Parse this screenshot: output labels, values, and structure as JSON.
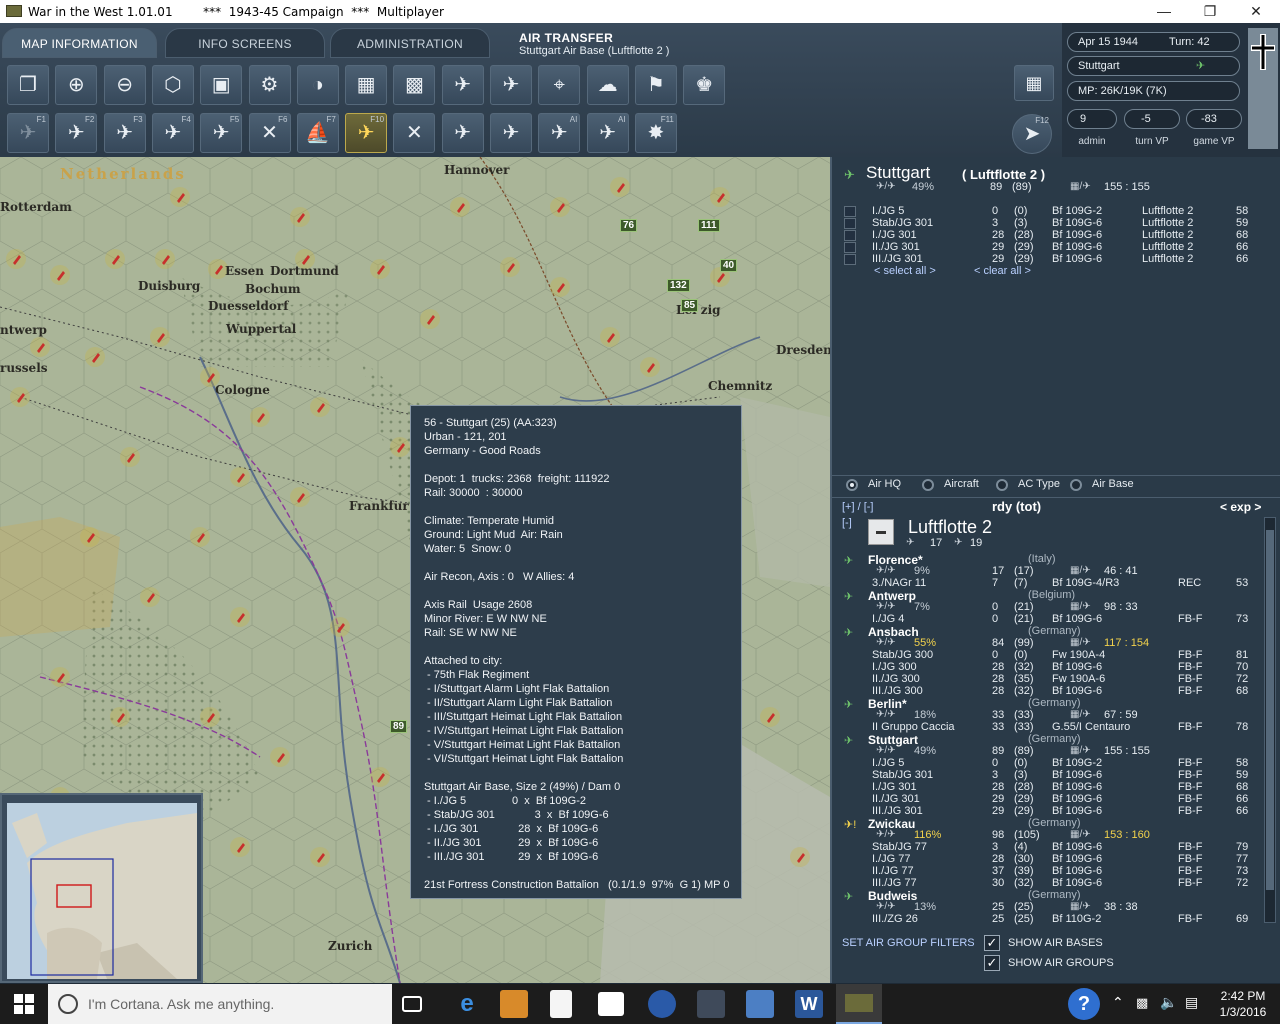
{
  "window": {
    "title": "War in the West 1.01.01        ***  1943-45 Campaign  ***  Multiplayer"
  },
  "tabs": [
    {
      "label": "MAP INFORMATION"
    },
    {
      "label": "INFO SCREENS"
    },
    {
      "label": "ADMINISTRATION"
    }
  ],
  "header": {
    "title": "AIR TRANSFER",
    "subtitle": "Stuttgart Air Base (Luftflotte 2 )"
  },
  "toolbar_row1": [
    {
      "icon": "windows-icon"
    },
    {
      "icon": "zoom-in-icon"
    },
    {
      "icon": "zoom-out-icon"
    },
    {
      "icon": "hex-icon"
    },
    {
      "icon": "frame-icon"
    },
    {
      "icon": "gear-icon"
    },
    {
      "icon": "unit-filter-icon"
    },
    {
      "icon": "supply-icon"
    },
    {
      "icon": "factory-icon"
    },
    {
      "icon": "air-strength-icon"
    },
    {
      "icon": "air-losses-icon"
    },
    {
      "icon": "recon-icon"
    },
    {
      "icon": "weather-icon"
    },
    {
      "icon": "flag-icon"
    },
    {
      "icon": "manpower-icon"
    }
  ],
  "toolbar_row2": [
    {
      "icon": "air-mission-icon",
      "key": "F1"
    },
    {
      "icon": "ground-attack-icon",
      "key": "F2"
    },
    {
      "icon": "bomb-icon",
      "key": "F3"
    },
    {
      "icon": "city-bomb-icon",
      "key": "F4"
    },
    {
      "icon": "air-recon-icon",
      "key": "F5"
    },
    {
      "icon": "sweep-icon",
      "key": "F6"
    },
    {
      "icon": "naval-attack-icon",
      "key": "F7"
    },
    {
      "icon": "air-transfer-icon",
      "key": "F10"
    },
    {
      "icon": "escort-icon",
      "key": ""
    },
    {
      "icon": "rail-icon",
      "key": ""
    },
    {
      "icon": "interdiction-icon",
      "key": ""
    },
    {
      "icon": "ai-bomb-icon",
      "key": "AI"
    },
    {
      "icon": "ai-plane-icon",
      "key": "AI"
    },
    {
      "icon": "explosion-icon",
      "key": "F11"
    }
  ],
  "end_turn_key": "F12",
  "info": {
    "date": "Apr 15 1944",
    "turn": "Turn: 42",
    "location": "Stuttgart",
    "mp": "MP:  26K/19K (7K)",
    "vp": [
      {
        "value": "9",
        "label": "admin"
      },
      {
        "value": "-5",
        "label": "turn VP"
      },
      {
        "value": "-83",
        "label": "game VP"
      }
    ]
  },
  "map": {
    "cities": [
      {
        "name": "Netherlands"
      },
      {
        "name": "Hannover"
      },
      {
        "name": "Rotterdam"
      },
      {
        "name": "Essen"
      },
      {
        "name": "Dortmund"
      },
      {
        "name": "Duisburg"
      },
      {
        "name": "Bochum"
      },
      {
        "name": "Duesseldorf"
      },
      {
        "name": "Wuppertal"
      },
      {
        "name": "ntwerp"
      },
      {
        "name": "russels"
      },
      {
        "name": "Cologne"
      },
      {
        "name": "Frankfur"
      },
      {
        "name": "Dresden"
      },
      {
        "name": "Chemnitz"
      },
      {
        "name": "Lei  zig"
      },
      {
        "name": "Zurich"
      }
    ],
    "units": [
      {
        "num": "76"
      },
      {
        "num": "111"
      },
      {
        "num": "40"
      },
      {
        "num": "132"
      },
      {
        "num": "85"
      },
      {
        "num": "89"
      }
    ]
  },
  "tooltip": {
    "lines": [
      "56 - Stuttgart (25) (AA:323)",
      "Urban - 121, 201",
      "Germany - Good Roads",
      "",
      "Depot: 1  trucks: 2368  freight: 111922",
      "Rail: 30000  : 30000",
      "",
      "Climate: Temperate Humid",
      "Ground: Light Mud  Air: Rain",
      "Water: 5  Snow: 0",
      "",
      "Air Recon, Axis : 0   W Allies: 4",
      "",
      "Axis Rail  Usage 2608",
      "Minor River: E W NW NE",
      "Rail: SE W NW NE",
      "",
      "Attached to city:",
      " - 75th Flak Regiment",
      " - I/Stuttgart Alarm Light Flak Battalion",
      " - II/Stuttgart Alarm Light Flak Battalion",
      " - III/Stuttgart Heimat Light Flak Battalion",
      " - IV/Stuttgart Heimat Light Flak Battalion",
      " - V/Stuttgart Heimat Light Flak Battalion",
      " - VI/Stuttgart Heimat Light Flak Battalion",
      "",
      "Stuttgart Air Base, Size 2 (49%) / Dam 0",
      " - I./JG 5               0  x  Bf 109G-2",
      " - Stab/JG 301             3  x  Bf 109G-6",
      " - I./JG 301             28  x  Bf 109G-6",
      " - II./JG 301            29  x  Bf 109G-6",
      " - III./JG 301           29  x  Bf 109G-6",
      "",
      "21st Fortress Construction Battalion   (0.1/1.9  97%  G 1) MP 0"
    ]
  },
  "base_panel": {
    "name": "Stuttgart",
    "hq": "( Luftflotte 2 )",
    "pct": "49%",
    "rdy": "89",
    "tot": "(89)",
    "supply": "155 : 155",
    "groups": [
      {
        "name": "I./JG 5",
        "rdy": "0",
        "tot": "(0)",
        "ac": "Bf 109G-2",
        "hq": "Luftflotte 2",
        "x": "58"
      },
      {
        "name": "Stab/JG 301",
        "rdy": "3",
        "tot": "(3)",
        "ac": "Bf 109G-6",
        "hq": "Luftflotte 2",
        "x": "59"
      },
      {
        "name": "I./JG 301",
        "rdy": "28",
        "tot": "(28)",
        "ac": "Bf 109G-6",
        "hq": "Luftflotte 2",
        "x": "68"
      },
      {
        "name": "II./JG 301",
        "rdy": "29",
        "tot": "(29)",
        "ac": "Bf 109G-6",
        "hq": "Luftflotte 2",
        "x": "66"
      },
      {
        "name": "III./JG 301",
        "rdy": "29",
        "tot": "(29)",
        "ac": "Bf 109G-6",
        "hq": "Luftflotte 2",
        "x": "66"
      }
    ],
    "select_all": "< select all >",
    "clear_all": "< clear all >"
  },
  "view_mode": {
    "options": [
      "Air HQ",
      "Aircraft",
      "AC Type",
      "Air Base"
    ]
  },
  "hq_list": {
    "expand_collapse": "[+] / [-]",
    "column": "rdy (tot)",
    "exp": "< exp >",
    "collapse": "[-]",
    "hq_name": "Luftflotte 2",
    "hq_air": "17",
    "hq_men": "19",
    "bases": [
      {
        "name": "Florence*",
        "country": "(Italy)",
        "pct": "9%",
        "rdy": "17",
        "tot": "(17)",
        "supply": "46 : 41",
        "groups": [
          {
            "name": "3./NAGr 11",
            "rdy": "7",
            "tot": "(7)",
            "ac": "Bf 109G-4/R3",
            "role": "REC",
            "x": "53"
          }
        ]
      },
      {
        "name": "Antwerp",
        "country": "(Belgium)",
        "pct": "7%",
        "rdy": "0",
        "tot": "(21)",
        "supply": "98 : 33",
        "groups": [
          {
            "name": "I./JG 4",
            "rdy": "0",
            "tot": "(21)",
            "ac": "Bf 109G-6",
            "role": "FB-F",
            "x": "73"
          }
        ]
      },
      {
        "name": "Ansbach",
        "country": "(Germany)",
        "pct": "55%",
        "rdy": "84",
        "tot": "(99)",
        "supply": "117 : 154",
        "groups": [
          {
            "name": "Stab/JG 300",
            "rdy": "0",
            "tot": "(0)",
            "ac": "Fw 190A-4",
            "role": "FB-F",
            "x": "81"
          },
          {
            "name": "I./JG 300",
            "rdy": "28",
            "tot": "(32)",
            "ac": "Bf 109G-6",
            "role": "FB-F",
            "x": "70"
          },
          {
            "name": "II./JG 300",
            "rdy": "28",
            "tot": "(35)",
            "ac": "Fw 190A-6",
            "role": "FB-F",
            "x": "72"
          },
          {
            "name": "III./JG 300",
            "rdy": "28",
            "tot": "(32)",
            "ac": "Bf 109G-6",
            "role": "FB-F",
            "x": "68"
          }
        ]
      },
      {
        "name": "Berlin*",
        "country": "(Germany)",
        "pct": "18%",
        "rdy": "33",
        "tot": "(33)",
        "supply": "67 : 59",
        "groups": [
          {
            "name": "II Gruppo Caccia",
            "rdy": "33",
            "tot": "(33)",
            "ac": "G.55/I Centauro",
            "role": "FB-F",
            "x": "78"
          }
        ]
      },
      {
        "name": "Stuttgart",
        "country": "(Germany)",
        "pct": "49%",
        "rdy": "89",
        "tot": "(89)",
        "supply": "155 : 155",
        "groups": [
          {
            "name": "I./JG 5",
            "rdy": "0",
            "tot": "(0)",
            "ac": "Bf 109G-2",
            "role": "FB-F",
            "x": "58"
          },
          {
            "name": "Stab/JG 301",
            "rdy": "3",
            "tot": "(3)",
            "ac": "Bf 109G-6",
            "role": "FB-F",
            "x": "59"
          },
          {
            "name": "I./JG 301",
            "rdy": "28",
            "tot": "(28)",
            "ac": "Bf 109G-6",
            "role": "FB-F",
            "x": "68"
          },
          {
            "name": "II./JG 301",
            "rdy": "29",
            "tot": "(29)",
            "ac": "Bf 109G-6",
            "role": "FB-F",
            "x": "66"
          },
          {
            "name": "III./JG 301",
            "rdy": "29",
            "tot": "(29)",
            "ac": "Bf 109G-6",
            "role": "FB-F",
            "x": "66"
          }
        ]
      },
      {
        "name": "Zwickau",
        "country": "(Germany)",
        "pct": "116%",
        "rdy": "98",
        "tot": "(105)",
        "supply": "153 : 160",
        "groups": [
          {
            "name": "Stab/JG 77",
            "rdy": "3",
            "tot": "(4)",
            "ac": "Bf 109G-6",
            "role": "FB-F",
            "x": "79"
          },
          {
            "name": "I./JG 77",
            "rdy": "28",
            "tot": "(30)",
            "ac": "Bf 109G-6",
            "role": "FB-F",
            "x": "77"
          },
          {
            "name": "II./JG 77",
            "rdy": "37",
            "tot": "(39)",
            "ac": "Bf 109G-6",
            "role": "FB-F",
            "x": "73"
          },
          {
            "name": "III./JG 77",
            "rdy": "30",
            "tot": "(32)",
            "ac": "Bf 109G-6",
            "role": "FB-F",
            "x": "72"
          }
        ]
      },
      {
        "name": "Budweis",
        "country": "(Germany)",
        "pct": "13%",
        "rdy": "25",
        "tot": "(25)",
        "supply": "38 : 38",
        "groups": [
          {
            "name": "III./ZG 26",
            "rdy": "25",
            "tot": "(25)",
            "ac": "Bf 110G-2",
            "role": "FB-F",
            "x": "69"
          }
        ]
      }
    ]
  },
  "filters": {
    "label": "SET AIR GROUP FILTERS",
    "show_air_bases": "SHOW AIR BASES",
    "show_air_groups": "SHOW AIR GROUPS"
  },
  "taskbar": {
    "search_placeholder": "I'm Cortana. Ask me anything.",
    "time": "2:42 PM",
    "date": "1/3/2016"
  }
}
